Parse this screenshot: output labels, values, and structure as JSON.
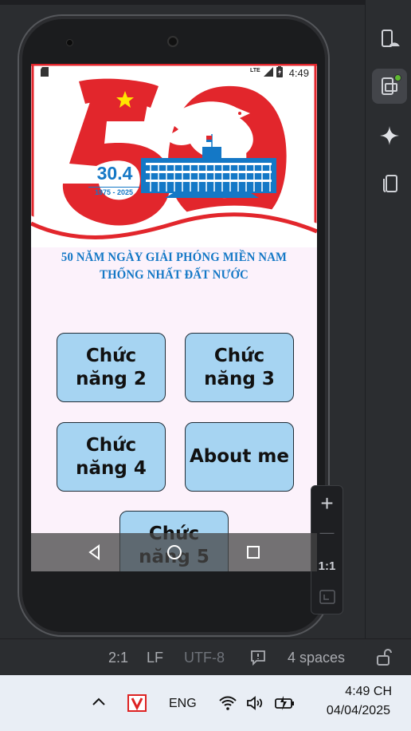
{
  "status_bar": {
    "network": "LTE",
    "time": "4:49"
  },
  "banner": {
    "number": "50",
    "date_big": "30.4",
    "date_years": "1975 - 2025",
    "slogan_line1": "50 NĂM NGÀY GIẢI PHÓNG MIỀN NAM",
    "slogan_line2": "THỐNG NHẤT ĐẤT NƯỚC"
  },
  "buttons": [
    {
      "label": "Chức năng 2"
    },
    {
      "label": "Chức năng 3"
    },
    {
      "label": "Chức năng 4"
    },
    {
      "label": "About me"
    },
    {
      "label": "Chức năng 5"
    }
  ],
  "zoom": {
    "plus": "+",
    "minus": "—",
    "ratio": "1:1"
  },
  "ide_status": {
    "position": "2:1",
    "line_sep": "LF",
    "encoding": "UTF-8",
    "indent": "4 spaces"
  },
  "taskbar": {
    "lang": "ENG",
    "time": "4:49 CH",
    "date": "04/04/2025"
  },
  "colors": {
    "button_bg": "#a6d4f2",
    "banner_red": "#e2262c",
    "banner_blue": "#1478c6",
    "page_bg": "#fcf2fb"
  }
}
